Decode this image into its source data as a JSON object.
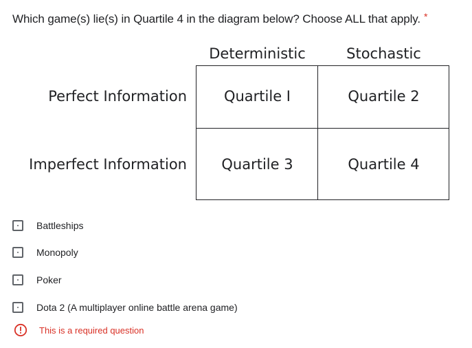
{
  "question": {
    "text": "Which game(s) lie(s) in Quartile 4 in the diagram below? Choose ALL that apply.",
    "required_marker": "*"
  },
  "diagram": {
    "column_headers": [
      "Deterministic",
      "Stochastic"
    ],
    "row_headers": [
      "Perfect Information",
      "Imperfect Information"
    ],
    "cells": [
      [
        "Quartile I",
        "Quartile 2"
      ],
      [
        "Quartile 3",
        "Quartile 4"
      ]
    ]
  },
  "options": [
    {
      "label": "Battleships",
      "checked": false
    },
    {
      "label": "Monopoly",
      "checked": false
    },
    {
      "label": "Poker",
      "checked": false
    },
    {
      "label": "Dota 2 (A multiplayer online battle arena game)",
      "checked": false
    }
  ],
  "validation": {
    "message": "This is a required question",
    "icon": "error-icon",
    "color": "#d93025"
  }
}
